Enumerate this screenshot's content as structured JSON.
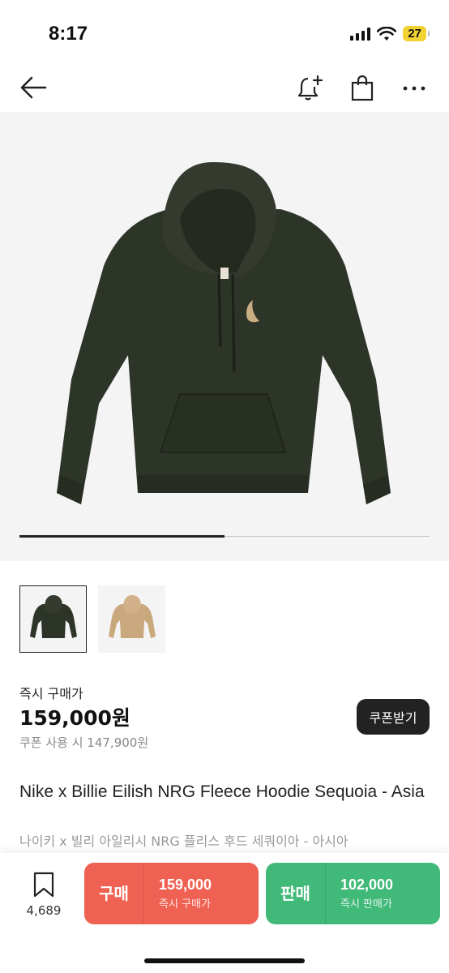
{
  "status_bar": {
    "time": "8:17",
    "battery": "27"
  },
  "product": {
    "gallery": {
      "progress": 0.5
    },
    "thumbnails": [
      {
        "icon": "hoodie-dark-green-thumbnail",
        "selected": true
      },
      {
        "icon": "hoodie-beige-thumbnail",
        "selected": false
      }
    ],
    "price_label": "즉시 구매가",
    "price": "159,000원",
    "coupon_price_text": "쿠폰 사용 시 147,900원",
    "coupon_button": "쿠폰받기",
    "title_en": "Nike x Billie Eilish NRG Fleece Hoodie Sequoia - Asia",
    "title_ko": "나이키 x 빌리 아일리시 NRG 플리스 후드 세쿼이아 - 아시아"
  },
  "bottom_bar": {
    "wish_count": "4,689",
    "buy": {
      "label": "구매",
      "price": "159,000",
      "sub": "즉시 구매가",
      "color": "#ef6253"
    },
    "sell": {
      "label": "판매",
      "price": "102,000",
      "sub": "즉시 판매가",
      "color": "#41b979"
    }
  }
}
